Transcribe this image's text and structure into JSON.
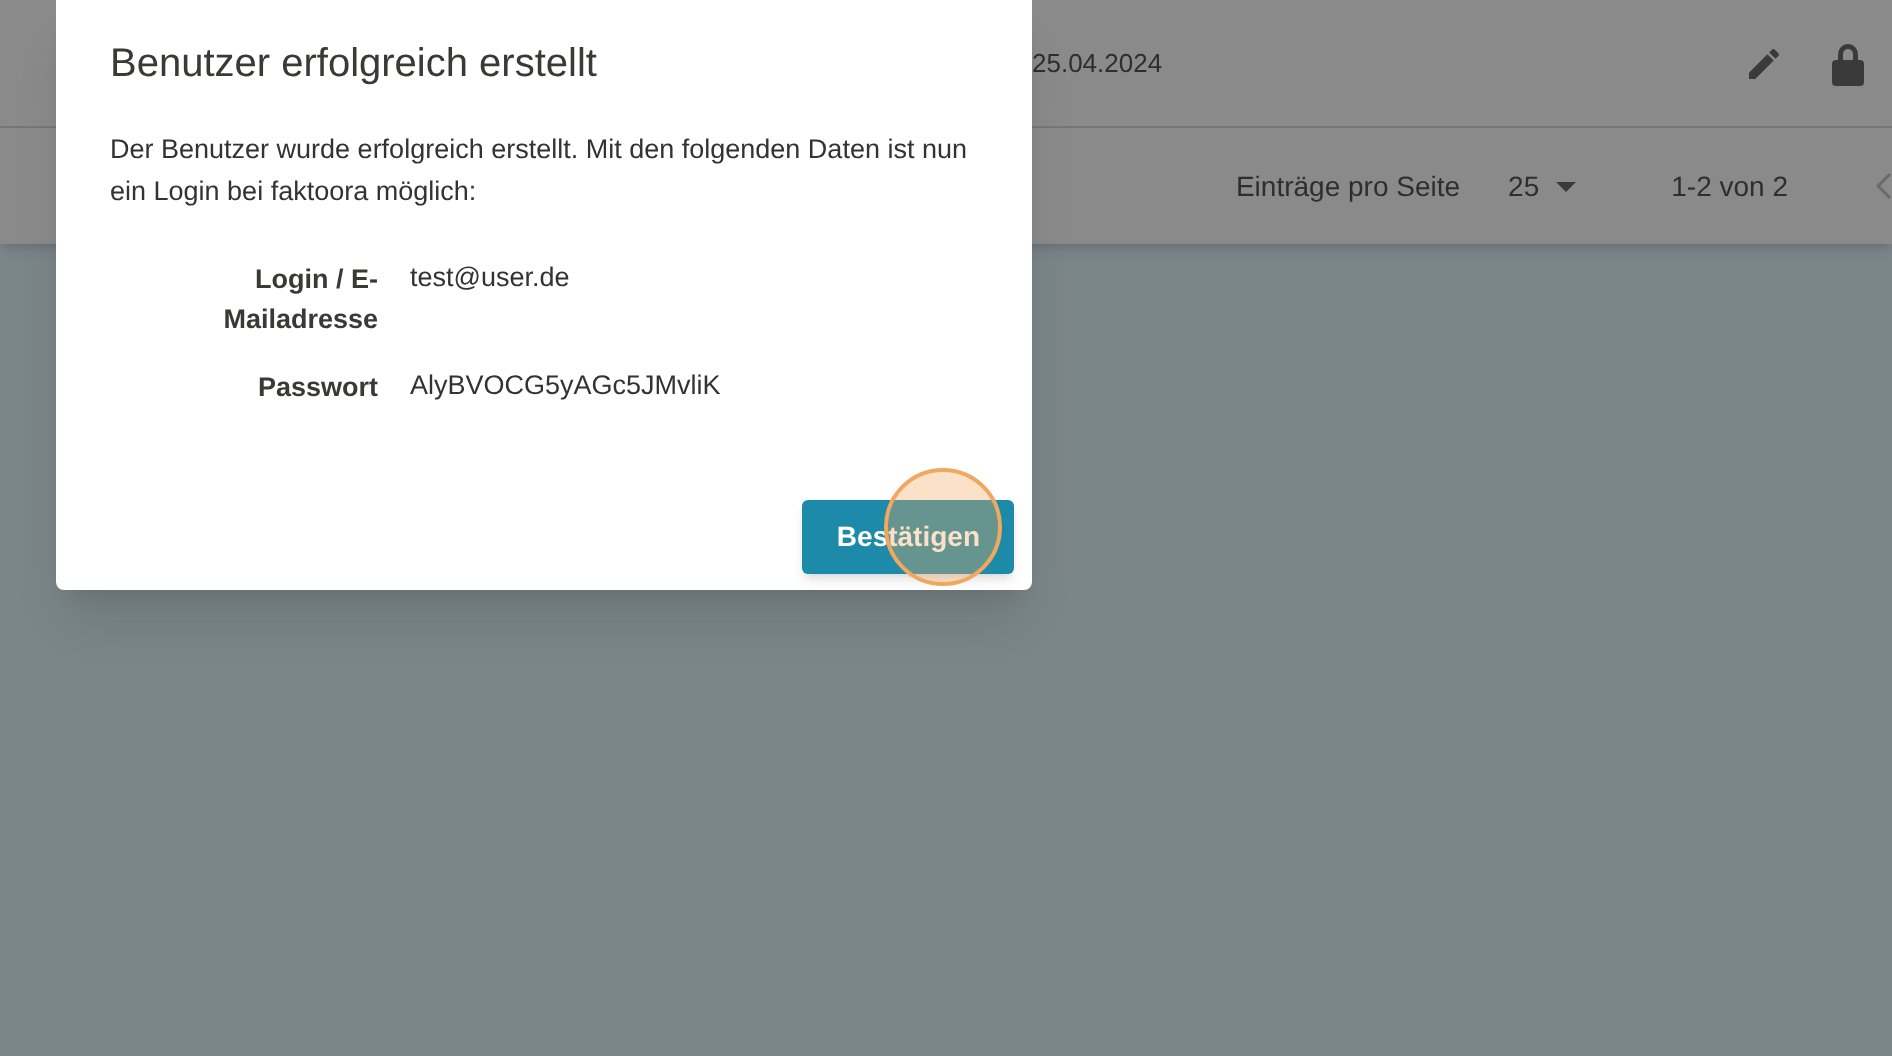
{
  "table": {
    "rows": [
      {
        "date": "25.04.2024"
      }
    ]
  },
  "paginator": {
    "label": "Einträge pro Seite",
    "page_size": "25",
    "range": "1-2 von 2"
  },
  "dialog": {
    "title": "Benutzer erfolgreich erstellt",
    "message": "Der Benutzer wurde erfolgreich erstellt. Mit den folgenden Daten ist nun ein Login bei faktoora möglich:",
    "fields": [
      {
        "label": "Login / E-Mailadresse",
        "value": "test@user.de"
      },
      {
        "label": "Passwort",
        "value": "AlyBVOCG5yAGc5JMvliK"
      }
    ],
    "confirm_button": "Bestätigen"
  }
}
